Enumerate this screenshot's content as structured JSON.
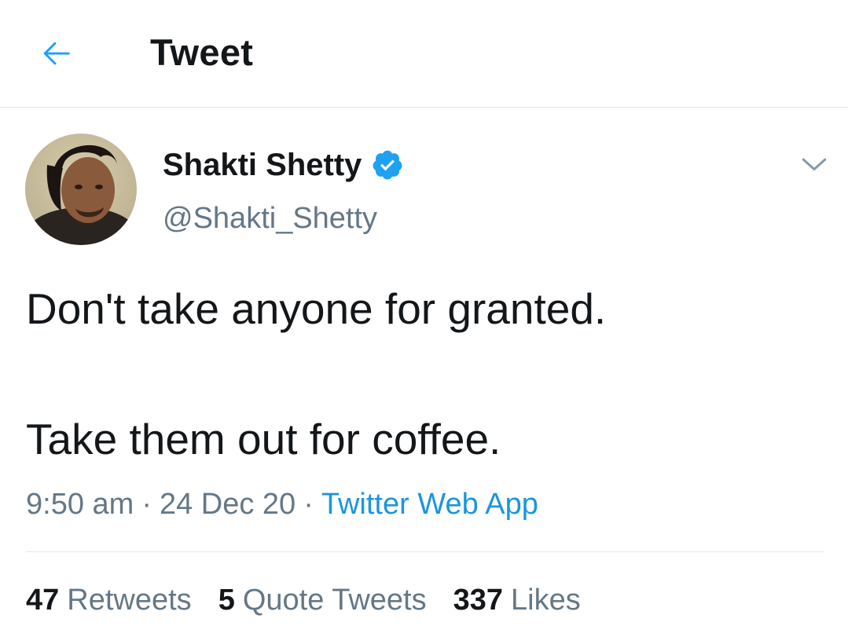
{
  "header": {
    "title": "Tweet",
    "back_icon": "arrow-left-icon",
    "accent": "#1da1f2"
  },
  "author": {
    "display_name": "Shakti Shetty",
    "handle": "@Shakti_Shetty",
    "verified": true,
    "verified_icon": "verified-badge-icon"
  },
  "menu": {
    "caret_icon": "chevron-down-icon"
  },
  "tweet": {
    "line1": "Don't take anyone for granted.",
    "line2": "Take them out for coffee."
  },
  "meta": {
    "time": "9:50 am",
    "separator": "·",
    "date": "24 Dec 20",
    "source": "Twitter Web App"
  },
  "stats": {
    "retweets_count": "47",
    "retweets_label": "Retweets",
    "quotes_count": "5",
    "quotes_label": "Quote Tweets",
    "likes_count": "337",
    "likes_label": "Likes"
  },
  "colors": {
    "text_primary": "#14171a",
    "text_secondary": "#657786",
    "link": "#1b95e0",
    "divider": "#e1e8ed"
  }
}
